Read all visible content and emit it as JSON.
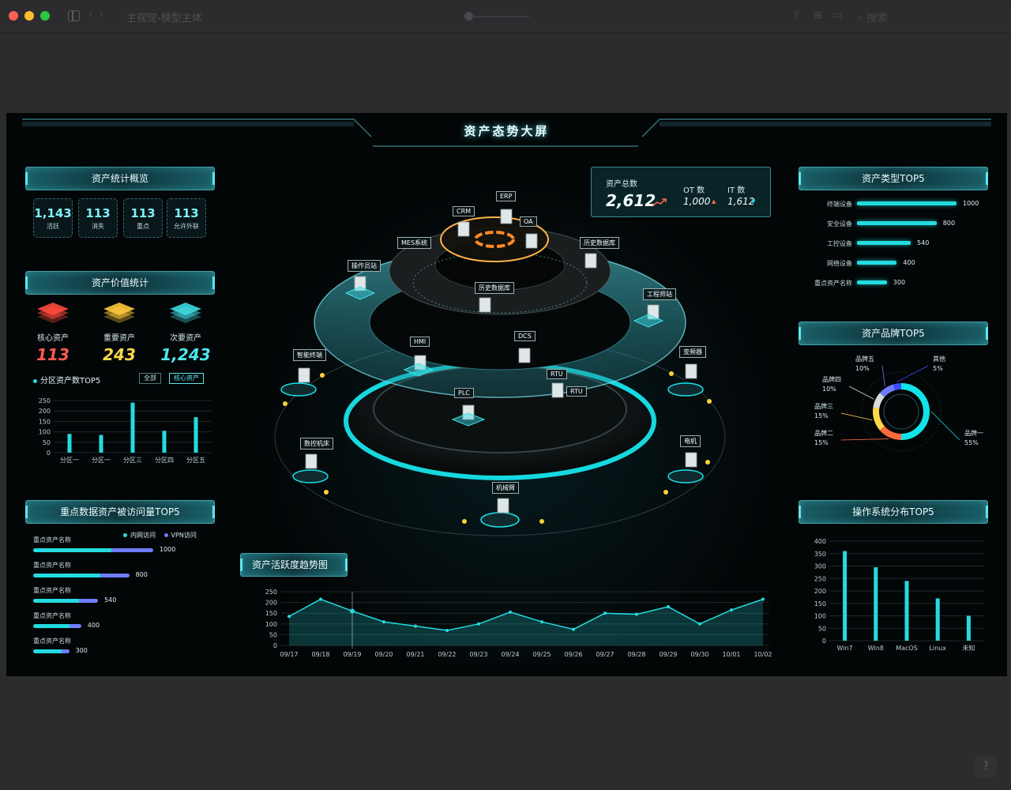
{
  "window": {
    "title": "主视觉-模型主体",
    "search_label": "搜索"
  },
  "dashboard": {
    "title": "资产态势大屏"
  },
  "asset_overview": {
    "title": "资产统计概览",
    "stats": [
      {
        "value": "1,143",
        "label": "活跃"
      },
      {
        "value": "113",
        "label": "消失"
      },
      {
        "value": "113",
        "label": "重点"
      },
      {
        "value": "113",
        "label": "允许外联"
      }
    ]
  },
  "asset_value": {
    "title": "资产价值统计",
    "items": [
      {
        "label": "核心资产",
        "value": "113",
        "color": "#ff5a4e"
      },
      {
        "label": "重要资产",
        "value": "243",
        "color": "#ffd64a"
      },
      {
        "label": "次要资产",
        "value": "1,243",
        "color": "#4fe6ee"
      }
    ],
    "zone_title": "分区资产数TOP5",
    "filter_all": "全部",
    "filter_core": "核心资产"
  },
  "access_top5": {
    "title": "重点数据资产被访问量TOP5",
    "legend_intranet": "内网访问",
    "legend_vpn": "VPN访问",
    "rows": [
      {
        "name": "重点资产名称",
        "value": "1000",
        "intranet": 650,
        "vpn": 350
      },
      {
        "name": "重点资产名称",
        "value": "800",
        "intranet": 560,
        "vpn": 240
      },
      {
        "name": "重点资产名称",
        "value": "540",
        "intranet": 380,
        "vpn": 160
      },
      {
        "name": "重点资产名称",
        "value": "400",
        "intranet": 300,
        "vpn": 100
      },
      {
        "name": "重点资产名称",
        "value": "300",
        "intranet": 240,
        "vpn": 60
      }
    ]
  },
  "totals": {
    "total_label": "资产总数",
    "total_value": "2,612",
    "ot_label": "OT 数",
    "ot_value": "1,000",
    "it_label": "IT 数",
    "it_value": "1,612"
  },
  "nodes": {
    "erp": "ERP",
    "crm": "CRM",
    "oa": "OA",
    "mes": "MES系统",
    "history_top": "历史数据库",
    "operator": "操作员站",
    "history_mid": "历史数据库",
    "engineer": "工程师站",
    "hmi": "HMI",
    "dcs": "DCS",
    "smart": "智能终端",
    "inverter": "变频器",
    "rtu1": "RTU",
    "rtu2": "RTU",
    "plc": "PLC",
    "cnc": "数控机床",
    "motor": "电机",
    "arm": "机械臂"
  },
  "activity": {
    "title": "资产活跃度趋势图"
  },
  "asset_type": {
    "title": "资产类型TOP5",
    "rows": [
      {
        "name": "终端设备",
        "value": 1000
      },
      {
        "name": "安全设备",
        "value": 800
      },
      {
        "name": "工控设备",
        "value": 540
      },
      {
        "name": "网络设备",
        "value": 400
      },
      {
        "name": "重点资产名称",
        "value": 300
      }
    ]
  },
  "brand": {
    "title": "资产品牌TOP5"
  },
  "os": {
    "title": "操作系统分布TOP5"
  },
  "chart_data": [
    {
      "type": "bar",
      "title": "分区资产数TOP5",
      "categories": [
        "分区一",
        "分区一",
        "分区三",
        "分区四",
        "分区五"
      ],
      "values": [
        90,
        85,
        240,
        105,
        170
      ],
      "ylim": [
        0,
        250
      ],
      "yticks": [
        0,
        50,
        100,
        150,
        200,
        250
      ],
      "color": "#24dbe0"
    },
    {
      "type": "area",
      "title": "资产活跃度趋势图",
      "x": [
        "09/17",
        "09/18",
        "09/19",
        "09/20",
        "09/21",
        "09/22",
        "09/23",
        "09/24",
        "09/25",
        "09/26",
        "09/27",
        "09/28",
        "09/29",
        "09/30",
        "10/01",
        "10/02"
      ],
      "values": [
        135,
        215,
        160,
        110,
        90,
        70,
        100,
        155,
        110,
        75,
        150,
        145,
        180,
        100,
        165,
        215
      ],
      "ylim": [
        0,
        250
      ],
      "yticks": [
        0,
        50,
        100,
        150,
        200,
        250
      ],
      "color": "#24dbe0"
    },
    {
      "type": "pie",
      "title": "资产品牌TOP5",
      "slices": [
        {
          "name": "品牌一",
          "value": 55,
          "label": "55%",
          "color": "#12e3e8"
        },
        {
          "name": "品牌二",
          "value": 15,
          "label": "15%",
          "color": "#ff6a3d"
        },
        {
          "name": "品牌三",
          "value": 15,
          "label": "15%",
          "color": "#ffd64a"
        },
        {
          "name": "品牌四",
          "value": 10,
          "label": "10%",
          "color": "#d9d9d9"
        },
        {
          "name": "品牌五",
          "value": 10,
          "label": "10%",
          "color": "#6f7dff"
        },
        {
          "name": "其他",
          "value": 5,
          "label": "5%",
          "color": "#3b4cff"
        }
      ]
    },
    {
      "type": "bar",
      "title": "操作系统分布TOP5",
      "categories": [
        "Win7",
        "Win8",
        "MacOS",
        "Linux",
        "未知"
      ],
      "values": [
        360,
        295,
        240,
        170,
        100
      ],
      "ylim": [
        0,
        400
      ],
      "yticks": [
        0,
        50,
        100,
        150,
        200,
        250,
        300,
        350,
        400
      ],
      "color": "#24dbe0"
    }
  ]
}
